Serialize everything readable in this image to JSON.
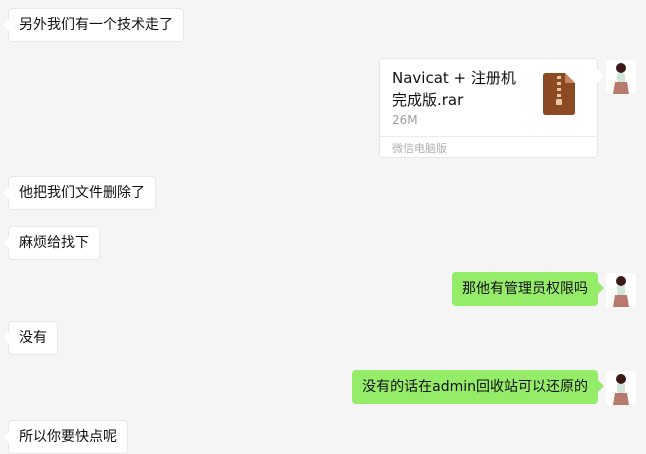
{
  "messages": [
    {
      "side": "in",
      "text": "另外我们有一个技术走了"
    },
    {
      "side": "out",
      "type": "file",
      "file_name": "Navicat + 注册机 完成版.rar",
      "file_size": "26M",
      "source": "微信电脑版"
    },
    {
      "side": "in",
      "text": "他把我们文件删除了"
    },
    {
      "side": "in",
      "text": "麻烦给找下"
    },
    {
      "side": "out",
      "text": "那他有管理员权限吗"
    },
    {
      "side": "in",
      "text": "没有"
    },
    {
      "side": "out",
      "text": "没有的话在admin回收站可以还原的"
    },
    {
      "side": "in",
      "text": "所以你要快点呢"
    }
  ],
  "colors": {
    "background": "#f5f5f5",
    "incoming_bubble": "#ffffff",
    "outgoing_bubble": "#95ec69",
    "file_icon": "#8b4a22"
  },
  "icons": {
    "file": "zip-archive-icon",
    "avatar": "user-avatar"
  }
}
